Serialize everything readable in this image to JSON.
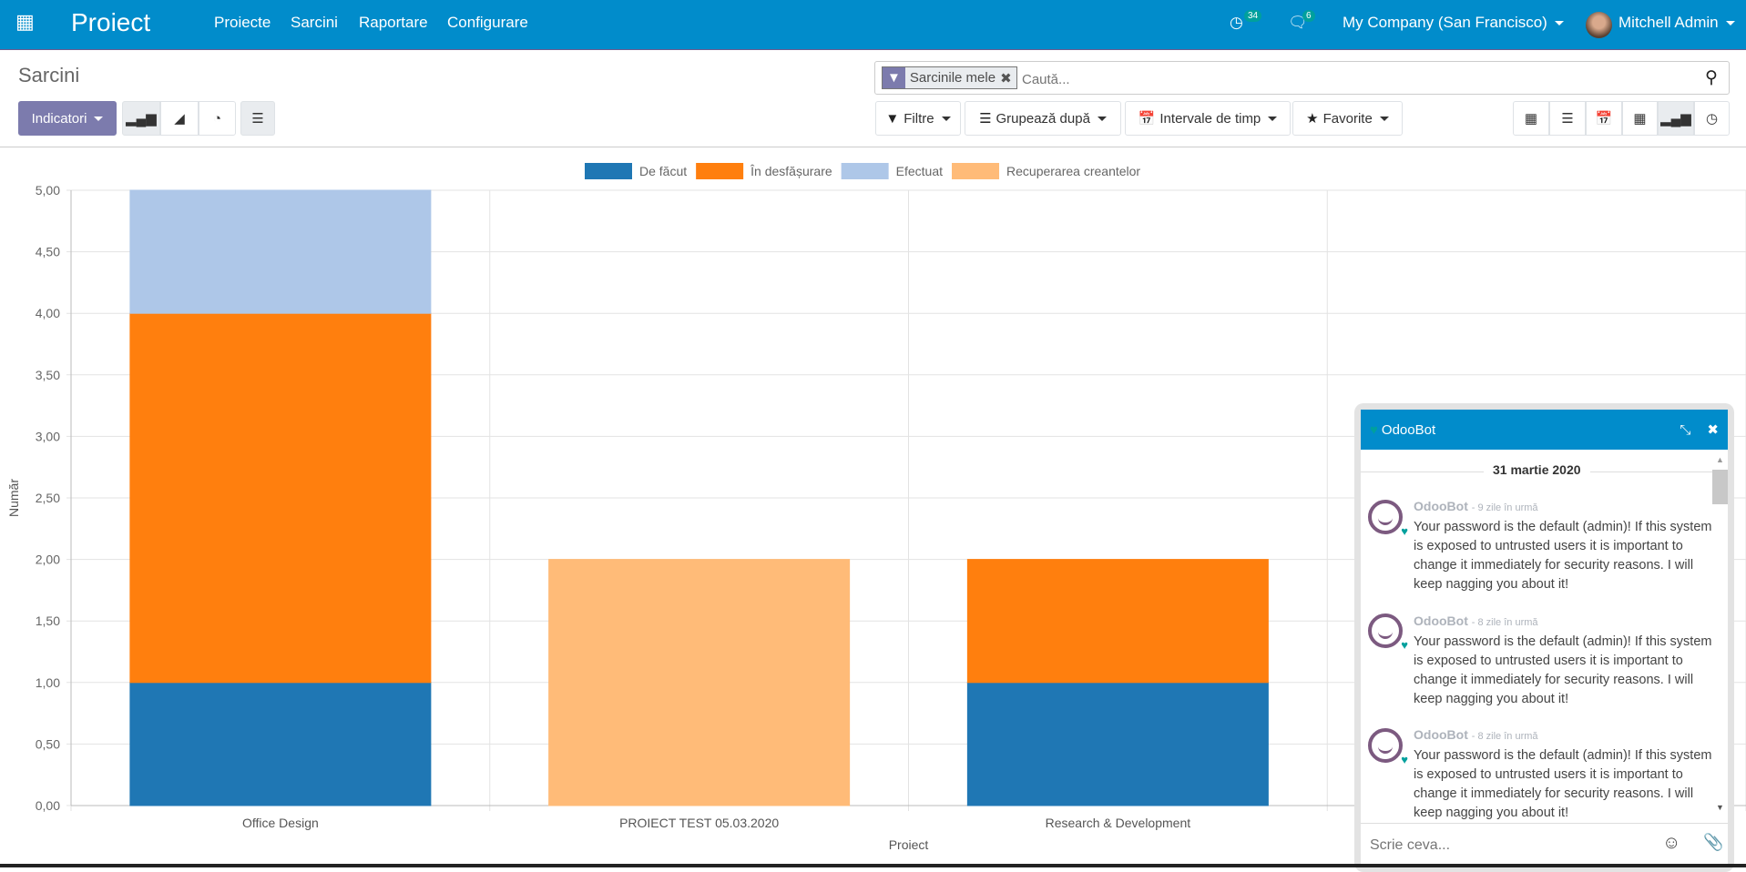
{
  "navbar": {
    "app_title": "Proiect",
    "menu": [
      "Proiecte",
      "Sarcini",
      "Raportare",
      "Configurare"
    ],
    "activity_count": "34",
    "messages_count": "6",
    "company": "My Company (San Francisco)",
    "user": "Mitchell Admin",
    "color": "#018ccb"
  },
  "control": {
    "breadcrumb": "Sarcini",
    "measures_label": "Indicatori",
    "search_facet": "Sarcinile mele",
    "search_placeholder": "Caută...",
    "filters": "Filtre",
    "group_by": "Grupează după",
    "time_ranges": "Intervale de timp",
    "favorites": "Favorite",
    "active_view": "graph",
    "active_chart_type": "bar"
  },
  "chart_data": {
    "type": "bar",
    "stacked": true,
    "categories": [
      "Office Design",
      "PROIECT TEST 05.03.2020",
      "Research & Development"
    ],
    "series": [
      {
        "name": "De făcut",
        "color": "#1f77b4",
        "values": [
          1,
          0,
          1
        ]
      },
      {
        "name": "În desfășurare",
        "color": "#ff7f0e",
        "values": [
          3,
          0,
          1
        ]
      },
      {
        "name": "Efectuat",
        "color": "#aec7e8",
        "values": [
          1,
          0,
          0
        ]
      },
      {
        "name": "Recuperarea creantelor",
        "color": "#ffbb78",
        "values": [
          0,
          2,
          0
        ]
      }
    ],
    "xlabel": "Proiect",
    "ylabel": "Număr",
    "ylim": [
      0,
      5
    ],
    "yticks": [
      "0,00",
      "0,50",
      "1,00",
      "1,50",
      "2,00",
      "2,50",
      "3,00",
      "3,50",
      "4,00",
      "4,50",
      "5,00"
    ],
    "grid": true,
    "legend": "top"
  },
  "chat": {
    "title": "OdooBot",
    "date": "31 martie 2020",
    "input_placeholder": "Scrie ceva...",
    "messages": [
      {
        "author": "OdooBot",
        "time": "- 9 zile în urmă",
        "text": "Your password is the default (admin)! If this system is exposed to untrusted users it is important to change it immediately for security reasons. I will keep nagging you about it!"
      },
      {
        "author": "OdooBot",
        "time": "- 8 zile în urmă",
        "text": "Your password is the default (admin)! If this system is exposed to untrusted users it is important to change it immediately for security reasons. I will keep nagging you about it!"
      },
      {
        "author": "OdooBot",
        "time": "- 8 zile în urmă",
        "text": "Your password is the default (admin)! If this system is exposed to untrusted users it is important to change it immediately for security reasons. I will keep nagging you about it!"
      }
    ]
  }
}
